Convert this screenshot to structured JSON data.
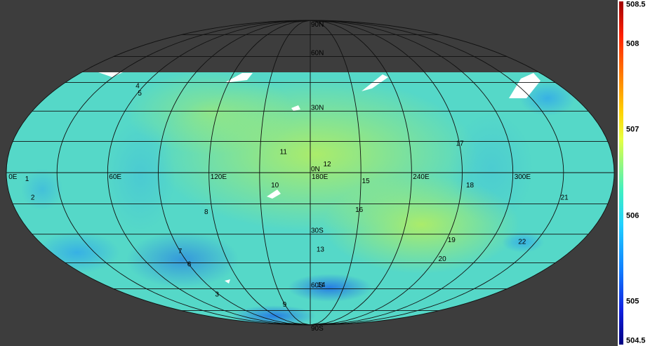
{
  "map": {
    "projection": "mollweide",
    "data_lat_coverage": [
      "67N",
      "90S"
    ],
    "lat_labels": [
      "90N",
      "60N",
      "30N",
      "0N",
      "30S",
      "60S",
      "90S"
    ],
    "lon_labels": [
      "0E",
      "60E",
      "120E",
      "180E",
      "240E",
      "300E"
    ],
    "features": [
      {
        "id": "1",
        "lat": -4,
        "lon": 12
      },
      {
        "id": "2",
        "lat": -13,
        "lon": 13
      },
      {
        "id": "3",
        "lat": -65,
        "lon": 85
      },
      {
        "id": "4",
        "lat": 42,
        "lon": 57
      },
      {
        "id": "5",
        "lat": 38,
        "lon": 63
      },
      {
        "id": "6",
        "lat": -47,
        "lon": 89
      },
      {
        "id": "7",
        "lat": -40,
        "lon": 89
      },
      {
        "id": "8",
        "lat": -20,
        "lon": 116
      },
      {
        "id": "9",
        "lat": -72,
        "lon": 148
      },
      {
        "id": "10",
        "lat": -7,
        "lon": 159
      },
      {
        "id": "11",
        "lat": 9,
        "lon": 164
      },
      {
        "id": "12",
        "lat": 3,
        "lon": 190
      },
      {
        "id": "13",
        "lat": -39,
        "lon": 187
      },
      {
        "id": "14",
        "lat": -59,
        "lon": 190
      },
      {
        "id": "15",
        "lat": -5,
        "lon": 213
      },
      {
        "id": "16",
        "lat": -19,
        "lon": 210
      },
      {
        "id": "17",
        "lat": 13,
        "lon": 270
      },
      {
        "id": "18",
        "lat": -7,
        "lon": 275
      },
      {
        "id": "19",
        "lat": -34,
        "lon": 274
      },
      {
        "id": "20",
        "lat": -44,
        "lon": 276
      },
      {
        "id": "21",
        "lat": -13,
        "lon": 333
      },
      {
        "id": "22",
        "lat": -35,
        "lon": 322
      }
    ]
  },
  "colorbar": {
    "min": 504.5,
    "max": 508.5,
    "ticks": [
      "508.5",
      "508",
      "507",
      "506",
      "505",
      "504.5"
    ],
    "tick_values": [
      508.5,
      508,
      507,
      506,
      505,
      504.5
    ],
    "colormap": "jet"
  },
  "colors": {
    "background": "#3d3d3d",
    "data_base": "#55d8c8",
    "data_high": "#a8ec70",
    "data_low": "#2a9cf0",
    "grid": "#111111",
    "gaps": "#ffffff"
  }
}
